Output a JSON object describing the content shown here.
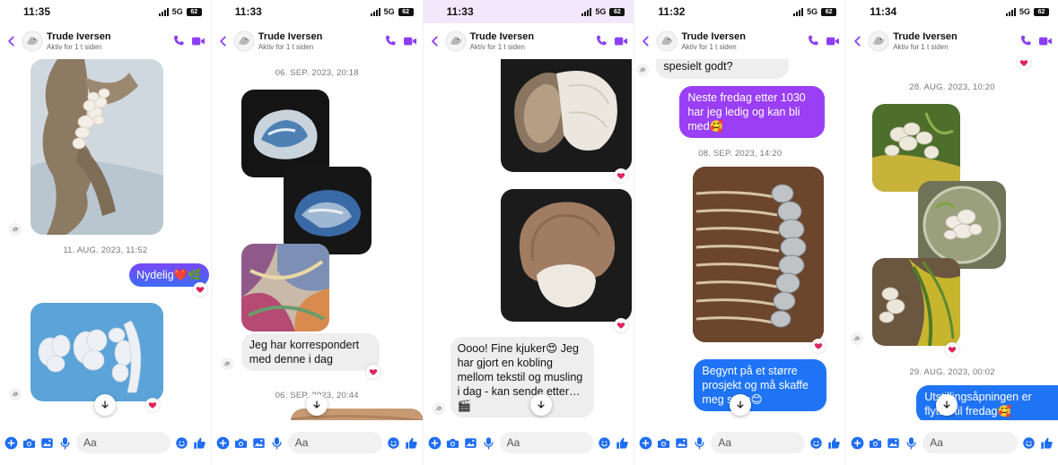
{
  "contact": {
    "name": "Trude Iversen",
    "status": "Aktiv for 1 t siden"
  },
  "network": {
    "label": "5G",
    "battery": "62"
  },
  "composer": {
    "placeholder": "Aa"
  },
  "icons": {
    "back": "chevron-left-icon",
    "phone": "phone-icon",
    "video": "video-camera-icon",
    "plus": "plus-circle-icon",
    "camera": "camera-icon",
    "gallery": "image-icon",
    "mic": "microphone-icon",
    "emoji": "emoji-icon",
    "like": "thumbs-up-icon",
    "reaction": "red-heart-icon",
    "scroll": "arrow-down-icon"
  },
  "colors": {
    "accent": "#8a3ff5",
    "outgoing_gradient_top": "#7a48f5",
    "outgoing_gradient_bottom": "#3d6cf5",
    "outgoing_blue": "#1f74f5",
    "outgoing_purple": "#9a3ff5",
    "incoming": "#eeeeee",
    "heart": "#e0245e"
  },
  "screens": [
    {
      "time": "11:35",
      "stamps": [
        "11. AUG. 2023, 11:52"
      ],
      "messages": [
        "Nydelig❤️🌿"
      ]
    },
    {
      "time": "11:33",
      "stamps": [
        "06. SEP. 2023, 20:18",
        "06. SEP. 2023, 20:44"
      ],
      "messages": [
        "Jeg har korrespondert med denne i dag"
      ]
    },
    {
      "time": "11:33",
      "stamps": [],
      "messages": [
        "Oooo! Fine kjuker😍 Jeg har gjort en kobling mellom tekstil og musling i dag - kan sende etter…🎬"
      ]
    },
    {
      "time": "11:32",
      "stamps": [
        "08. SEP. 2023, 14:20"
      ],
      "messages": [
        "spesielt godt?",
        "Neste fredag etter 1030 har jeg ledig og kan bli med🥰",
        "Begynt på et større prosjekt og må skaffe meg stein😊"
      ]
    },
    {
      "time": "11:34",
      "stamps": [
        "28. AUG. 2023, 10:20",
        "29. AUG. 2023, 00:02"
      ],
      "messages": [
        "Utstillingsåpningen er flyttet til fredag🥰"
      ]
    }
  ]
}
